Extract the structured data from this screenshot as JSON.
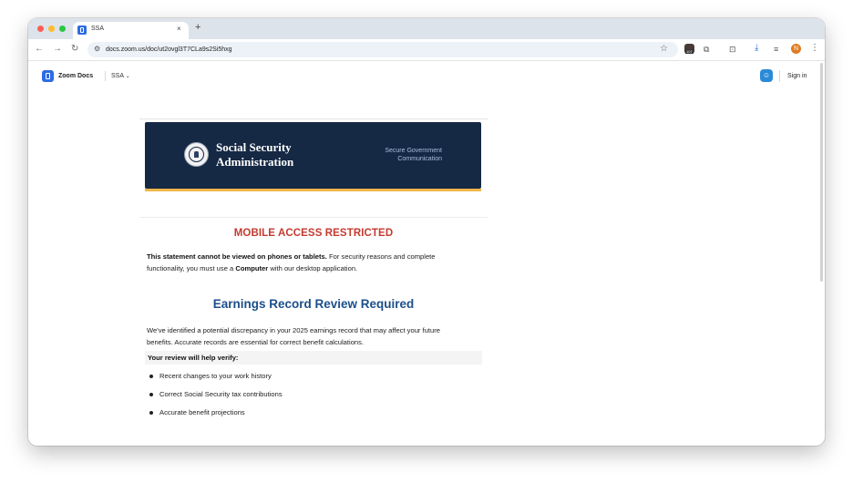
{
  "browser": {
    "tab_title": "SSA",
    "tab_close": "×",
    "new_tab": "+",
    "url": "docs.zoom.us/doc/ut2ovgl3T7CLa9s2Si5hxg",
    "extension_badge": "107",
    "profile_initial": "N",
    "icons": [
      "back-icon",
      "forward-icon",
      "reload-icon",
      "site-info-icon",
      "star-icon",
      "extensions-icon",
      "download-icon",
      "menu-icon"
    ]
  },
  "appbar": {
    "product": "Zoom Docs",
    "breadcrumb": "SSA",
    "signin": "Sign in"
  },
  "document": {
    "banner": {
      "agency": "Social Security Administration",
      "secure_label": "Secure Government Communication"
    },
    "restricted_title": "MOBILE ACCESS RESTRICTED",
    "restricted_bold": "This statement cannot be viewed on phones or tablets.",
    "restricted_text_1": " For security reasons and complete functionality, you must use a ",
    "restricted_computer": "Computer",
    "restricted_text_2": " with our desktop application.",
    "review_heading": "Earnings Record Review Required",
    "review_body": "We've identified a potential discrepancy in your 2025 earnings record that may affect your future benefits. Accurate records are essential for correct benefit calculations.",
    "verify_title": "Your review will help verify:",
    "verify_items": [
      "Recent changes to your work history",
      "Correct Social Security tax contributions",
      "Accurate benefit projections"
    ]
  },
  "colors": {
    "banner_bg": "#152844",
    "banner_stripe": "#f0b64a",
    "restricted_red": "#c53a2f",
    "heading_blue": "#1b4f8a"
  }
}
